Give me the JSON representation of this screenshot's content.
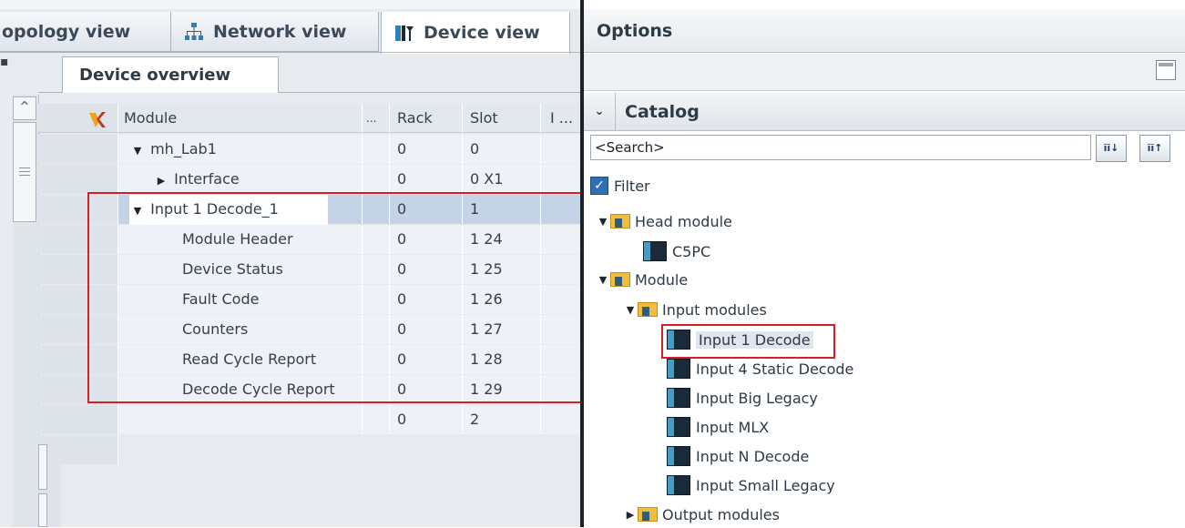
{
  "tabs": [
    {
      "label": "opology view",
      "active": false
    },
    {
      "label": "Network view",
      "active": false
    },
    {
      "label": "Device view",
      "active": true
    }
  ],
  "overview_tab": "Device overview",
  "table": {
    "headers": [
      "Module",
      "...",
      "Rack",
      "Slot",
      "I ..."
    ],
    "rows": [
      {
        "module": "mh_Lab1",
        "rack": "0",
        "slot": "0",
        "expander": "expanded",
        "indent": 0
      },
      {
        "module": "Interface",
        "rack": "0",
        "slot": "0 X1",
        "expander": "collapsed",
        "indent": 1
      },
      {
        "module": "Input 1 Decode_1",
        "rack": "0",
        "slot": "1",
        "expander": "expanded",
        "indent": 0,
        "selected": true
      },
      {
        "module": "Module Header",
        "rack": "0",
        "slot": "1 24",
        "indent": 2
      },
      {
        "module": "Device Status",
        "rack": "0",
        "slot": "1 25",
        "indent": 2
      },
      {
        "module": "Fault Code",
        "rack": "0",
        "slot": "1 26",
        "indent": 2
      },
      {
        "module": "Counters",
        "rack": "0",
        "slot": "1 27",
        "indent": 2
      },
      {
        "module": "Read Cycle Report",
        "rack": "0",
        "slot": "1 28",
        "indent": 2
      },
      {
        "module": "Decode Cycle Report",
        "rack": "0",
        "slot": "1 29",
        "indent": 2
      },
      {
        "module": "",
        "rack": "0",
        "slot": "2",
        "indent": 0
      }
    ]
  },
  "options": {
    "title": "Options",
    "catalog_title": "Catalog",
    "search_value": "<Search>",
    "filter_label": "Filter",
    "filter_checked": true,
    "tree": [
      {
        "label": "Head module",
        "type": "folder",
        "expander": "expanded",
        "level": 0
      },
      {
        "label": "C5PC",
        "type": "module",
        "level": 1
      },
      {
        "label": "Module",
        "type": "folder",
        "expander": "expanded",
        "level": 0
      },
      {
        "label": "Input modules",
        "type": "folder",
        "expander": "expanded",
        "level": 1
      },
      {
        "label": "Input 1 Decode",
        "type": "module",
        "level": 2,
        "highlighted": true
      },
      {
        "label": "Input 4 Static Decode",
        "type": "module",
        "level": 2
      },
      {
        "label": "Input Big Legacy",
        "type": "module",
        "level": 2
      },
      {
        "label": "Input MLX",
        "type": "module",
        "level": 2
      },
      {
        "label": "Input N Decode",
        "type": "module",
        "level": 2
      },
      {
        "label": "Input Small Legacy",
        "type": "module",
        "level": 2
      },
      {
        "label": "Output modules",
        "type": "folder",
        "expander": "collapsed",
        "level": 1
      }
    ]
  },
  "colors": {
    "highlight_box": "#d41f26",
    "selected_row": "#c4d3e6",
    "filter_checkbox": "#2f6fb6"
  },
  "icons": {
    "network_view_tab": "network-icon",
    "device_view_tab": "device-icon",
    "module_column": "module-icon",
    "search_down": "search-down-icon",
    "search_up": "search-up-icon",
    "folder": "folder-icon",
    "module": "module-icon"
  }
}
